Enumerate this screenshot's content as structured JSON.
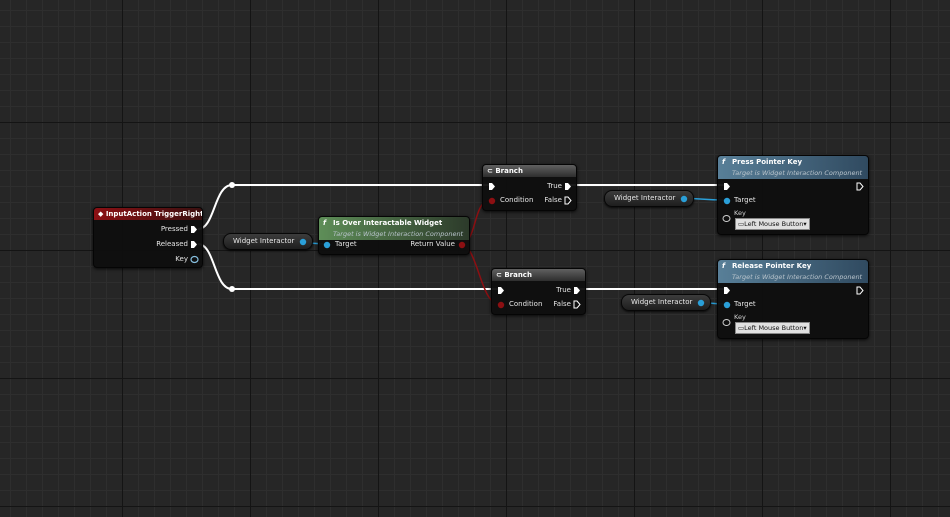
{
  "input_event": {
    "title": "InputAction TriggerRight",
    "pins": {
      "pressed": "Pressed",
      "released": "Released",
      "key": "Key"
    }
  },
  "widget_interactor_label": "Widget Interactor",
  "is_over": {
    "title": "Is Over Interactable Widget",
    "subtitle": "Target is Widget Interaction Component",
    "target": "Target",
    "return_value": "Return Value"
  },
  "branch": {
    "title": "Branch",
    "condition": "Condition",
    "true": "True",
    "false": "False"
  },
  "press": {
    "title": "Press Pointer Key",
    "subtitle": "Target is Widget Interaction Component",
    "target": "Target",
    "key_label": "Key",
    "key_value": "Left Mouse Button"
  },
  "release": {
    "title": "Release Pointer Key",
    "subtitle": "Target is Widget Interaction Component",
    "target": "Target",
    "key_label": "Key",
    "key_value": "Left Mouse Button"
  },
  "colors": {
    "exec": "#ffffff",
    "object_pin": "#2a9fd8",
    "bool_pin": "#8c0f12",
    "struct_pin": "#87c0e0",
    "event_header": "#8c1014",
    "function_header": "#587f98",
    "pure_header": "#5e8e58"
  }
}
